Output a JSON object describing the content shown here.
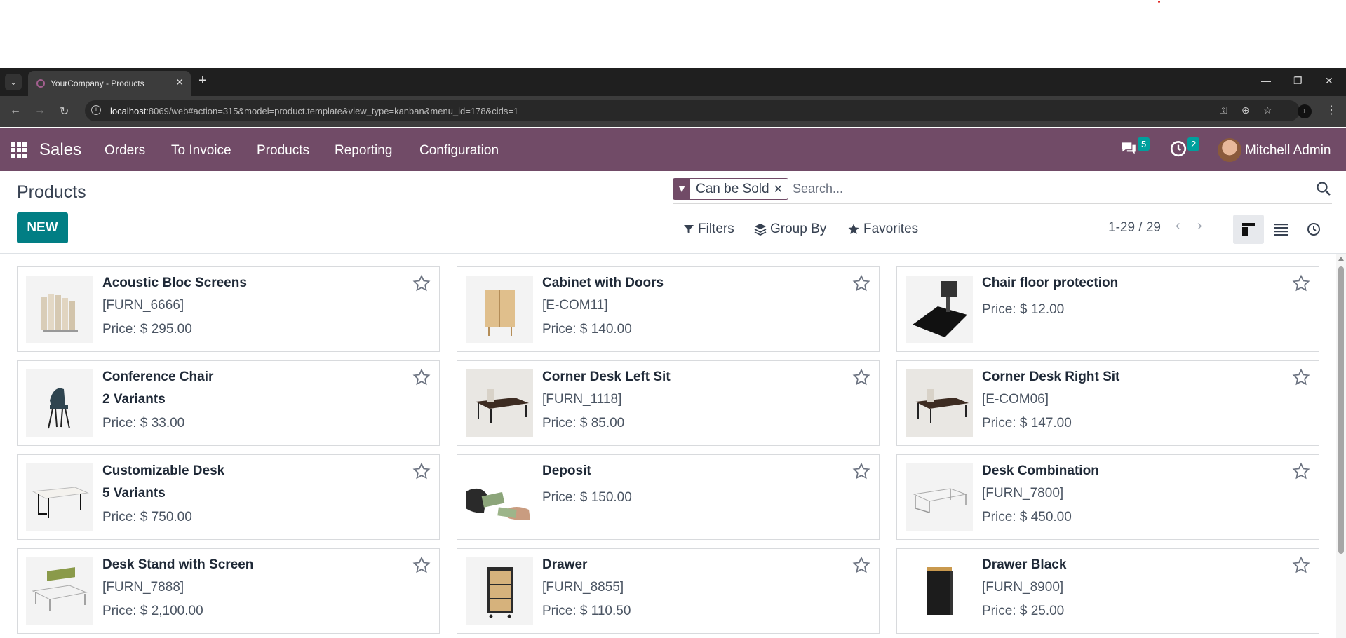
{
  "browser": {
    "tab_title": "YourCompany - Products",
    "url_host": "localhost",
    "url_rest": ":8069/web#action=315&model=product.template&view_type=kanban&menu_id=178&cids=1"
  },
  "navbar": {
    "app_name": "Sales",
    "menu": [
      "Orders",
      "To Invoice",
      "Products",
      "Reporting",
      "Configuration"
    ],
    "messages_count": "5",
    "activities_count": "2",
    "user_name": "Mitchell Admin",
    "brand_color": "#714b67"
  },
  "control_panel": {
    "title": "Products",
    "new_label": "NEW",
    "facet_label": "Can be Sold",
    "search_placeholder": "Search...",
    "filters_label": "Filters",
    "groupby_label": "Group By",
    "favorites_label": "Favorites",
    "pager": "1-29 / 29"
  },
  "products": [
    {
      "name": "Acoustic Bloc Screens",
      "line2": "[FURN_6666]",
      "price": "Price: $ 295.00",
      "icon": "acoustic-screen-image"
    },
    {
      "name": "Cabinet with Doors",
      "line2": "[E-COM11]",
      "price": "Price: $ 140.00",
      "icon": "cabinet-image"
    },
    {
      "name": "Chair floor protection",
      "line2": "",
      "price": "Price: $ 12.00",
      "icon": "floor-mat-image"
    },
    {
      "name": "Conference Chair",
      "line2": "2 Variants",
      "price": "Price: $ 33.00",
      "icon": "chair-image"
    },
    {
      "name": "Corner Desk Left Sit",
      "line2": "[FURN_1118]",
      "price": "Price: $ 85.00",
      "icon": "corner-desk-image"
    },
    {
      "name": "Corner Desk Right Sit",
      "line2": "[E-COM06]",
      "price": "Price: $ 147.00",
      "icon": "corner-desk-image"
    },
    {
      "name": "Customizable Desk",
      "line2": "5 Variants",
      "price": "Price: $ 750.00",
      "icon": "desk-image"
    },
    {
      "name": "Deposit",
      "line2": "",
      "price": "Price: $ 150.00",
      "icon": "money-image"
    },
    {
      "name": "Desk Combination",
      "line2": "[FURN_7800]",
      "price": "Price: $ 450.00",
      "icon": "desk-combination-image"
    },
    {
      "name": "Desk Stand with Screen",
      "line2": "[FURN_7888]",
      "price": "Price: $ 2,100.00",
      "icon": "desk-screen-image"
    },
    {
      "name": "Drawer",
      "line2": "[FURN_8855]",
      "price": "Price: $ 110.50",
      "icon": "drawer-image"
    },
    {
      "name": "Drawer Black",
      "line2": "[FURN_8900]",
      "price": "Price: $ 25.00",
      "icon": "drawer-black-image"
    }
  ]
}
